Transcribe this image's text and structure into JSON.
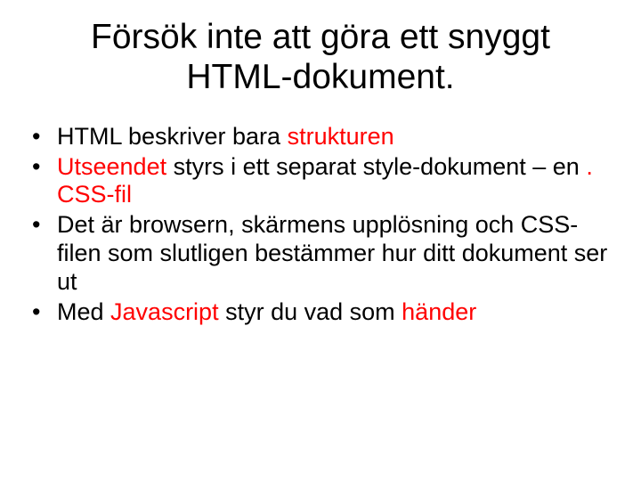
{
  "title": "Försök inte att göra ett snyggt HTML-dokument.",
  "bullets": {
    "b1a": "HTML beskriver bara ",
    "b1b": "strukturen",
    "b2a": "Utseendet",
    "b2b": " styrs i ett separat style-dokument – en ",
    "b2c": ". CSS-fil",
    "b3": "Det är browsern, skärmens upplösning och CSS-filen som slutligen bestämmer hur ditt dokument ser ut",
    "b4a": "Med ",
    "b4b": "Javascript",
    "b4c": " styr du vad som ",
    "b4d": "händer"
  }
}
